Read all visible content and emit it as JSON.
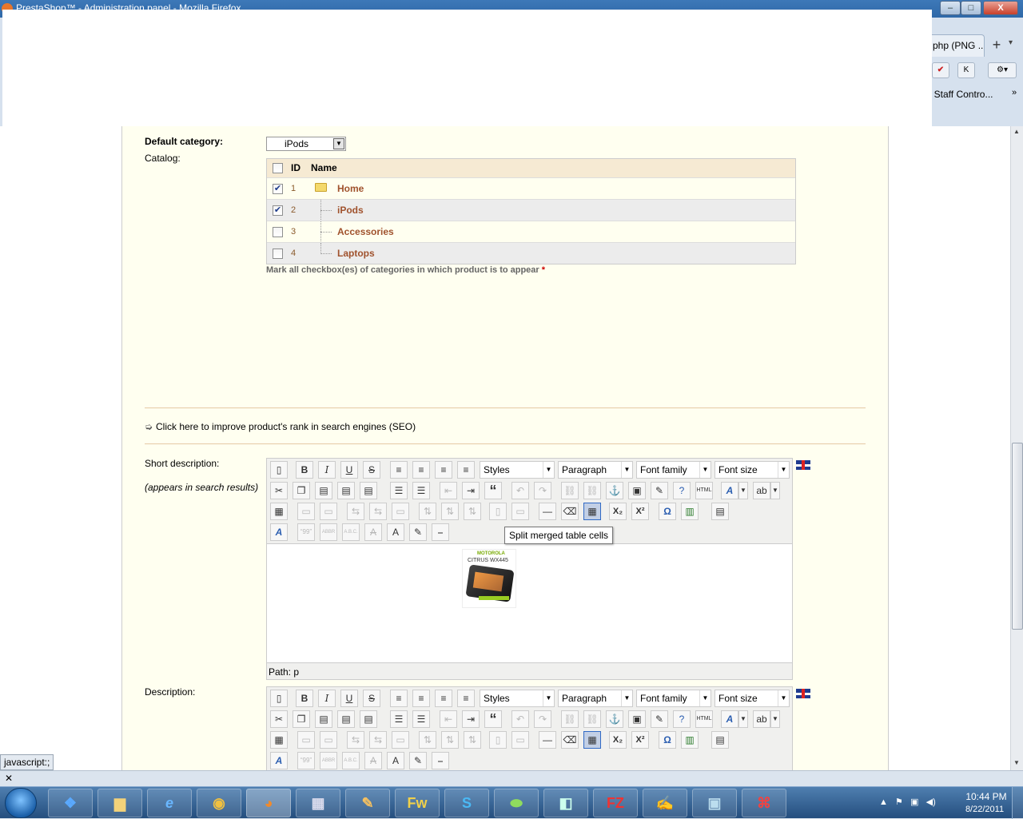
{
  "window": {
    "title": "PrestaShop™ - Administration panel - Mozilla Firefox",
    "minimize": "–",
    "maximize": "□",
    "close": "X"
  },
  "browser": {
    "tab_label": "php (PNG ...",
    "new_tab": "+",
    "bookmark_text": ": Staff Contro...",
    "toolbar_icons": [
      "adblock-icon",
      "k-icon",
      "addon-icon"
    ]
  },
  "form": {
    "default_category_label": "Default category:",
    "default_category_value": "iPods",
    "catalog_label": "Catalog:",
    "table": {
      "headers": {
        "id": "ID",
        "name": "Name"
      },
      "rows": [
        {
          "id": "1",
          "name": "Home",
          "checked": "✔"
        },
        {
          "id": "2",
          "name": "iPods",
          "checked": "✔"
        },
        {
          "id": "3",
          "name": "Accessories",
          "checked": ""
        },
        {
          "id": "4",
          "name": "Laptops",
          "checked": ""
        }
      ]
    },
    "catalog_note": "Mark all checkbox(es) of categories in which product is to appear",
    "catalog_note_required": "*",
    "seo_link": "Click here to improve product's rank in search engines (SEO)",
    "short_description_label": "Short description:",
    "short_description_hint": "(appears in search results)",
    "description_label": "Description:"
  },
  "editor": {
    "styles": "Styles",
    "format": "Paragraph",
    "font_family": "Font family",
    "font_size": "Font size",
    "bold": "B",
    "italic": "I",
    "underline": "U",
    "strike": "S",
    "quote": "“",
    "omega": "Ω",
    "subscript": "X₂",
    "superscript": "X²",
    "path": "Path: p",
    "tooltip": "Split merged table cells",
    "image_brand": "MOTOROLA",
    "image_model": "CITRUS WX445"
  },
  "statusbar": {
    "text": "javascript:;",
    "addon_close": "✕"
  },
  "taskbar": {
    "apps": [
      "dropbox",
      "explorer",
      "internet-explorer",
      "chrome",
      "firefox",
      "calculator",
      "paint",
      "Fw",
      "skype",
      "app",
      "notes",
      "filezilla",
      "notepad++",
      "photos",
      "acrobat"
    ],
    "fireworks_label": "Fw",
    "filezilla_label": "FZ",
    "time": "10:44 PM",
    "date": "8/22/2011"
  }
}
